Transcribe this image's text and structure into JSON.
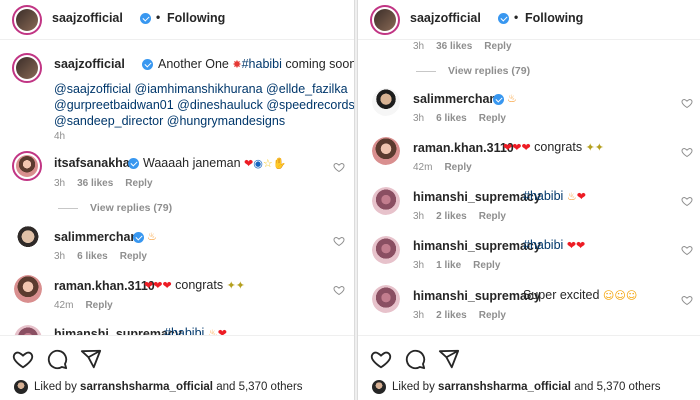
{
  "post": {
    "author": "saajzofficial",
    "follow_status": "Following",
    "separator": "•"
  },
  "caption": {
    "username": "saajzofficial",
    "text_prefix": "Another One",
    "hashtag": "#habibi",
    "text_suffix": "coming soon",
    "mentions_line1": "@saajzofficial @iamhimanshikhurana @ellde_fazilka",
    "mentions_line2": "@gurpreetbaidwan01 @dineshauluck @speedrecords",
    "mentions_line3": "@sandeep_director @hungrymandesigns",
    "time": "4h"
  },
  "comments": [
    {
      "id": "afsana",
      "username": "itsafsanakhan",
      "text": "Waaaah janeman",
      "time": "3h",
      "likes": "36 likes",
      "reply": "Reply",
      "view_replies": "View replies (79)"
    },
    {
      "id": "salim",
      "username": "salimmerchant",
      "text": "",
      "time": "3h",
      "likes": "6 likes",
      "reply": "Reply"
    },
    {
      "id": "raman",
      "username": "raman.khan.3110",
      "text": "congrats",
      "time": "42m",
      "reply": "Reply"
    },
    {
      "id": "himanshi1",
      "username": "himanshi_supremacy",
      "hashtag": "#habibi",
      "time": "3h",
      "likes": "2 likes",
      "reply": "Reply"
    },
    {
      "id": "himanshi2",
      "username": "himanshi_supremacy",
      "hashtag": "#habibi",
      "time": "3h",
      "likes": "1 like",
      "reply": "Reply"
    },
    {
      "id": "himanshi3",
      "username": "himanshi_supremacy",
      "text": "Super excited",
      "time": "3h",
      "likes": "2 likes",
      "reply": "Reply"
    }
  ],
  "footer": {
    "liked_by_prefix": "Liked by",
    "liked_by_user": "sarranshsharma_official",
    "liked_by_suffix": "and 5,370 others"
  },
  "icons": {
    "like": "heart-outline-icon",
    "comment": "comment-bubble-icon",
    "share": "paper-plane-icon",
    "verified": "verified-badge-icon"
  },
  "colors": {
    "verified": "#3897f0",
    "hashtag": "#00376b",
    "meta": "#8e8e8e",
    "heart": "#ed1c24"
  }
}
